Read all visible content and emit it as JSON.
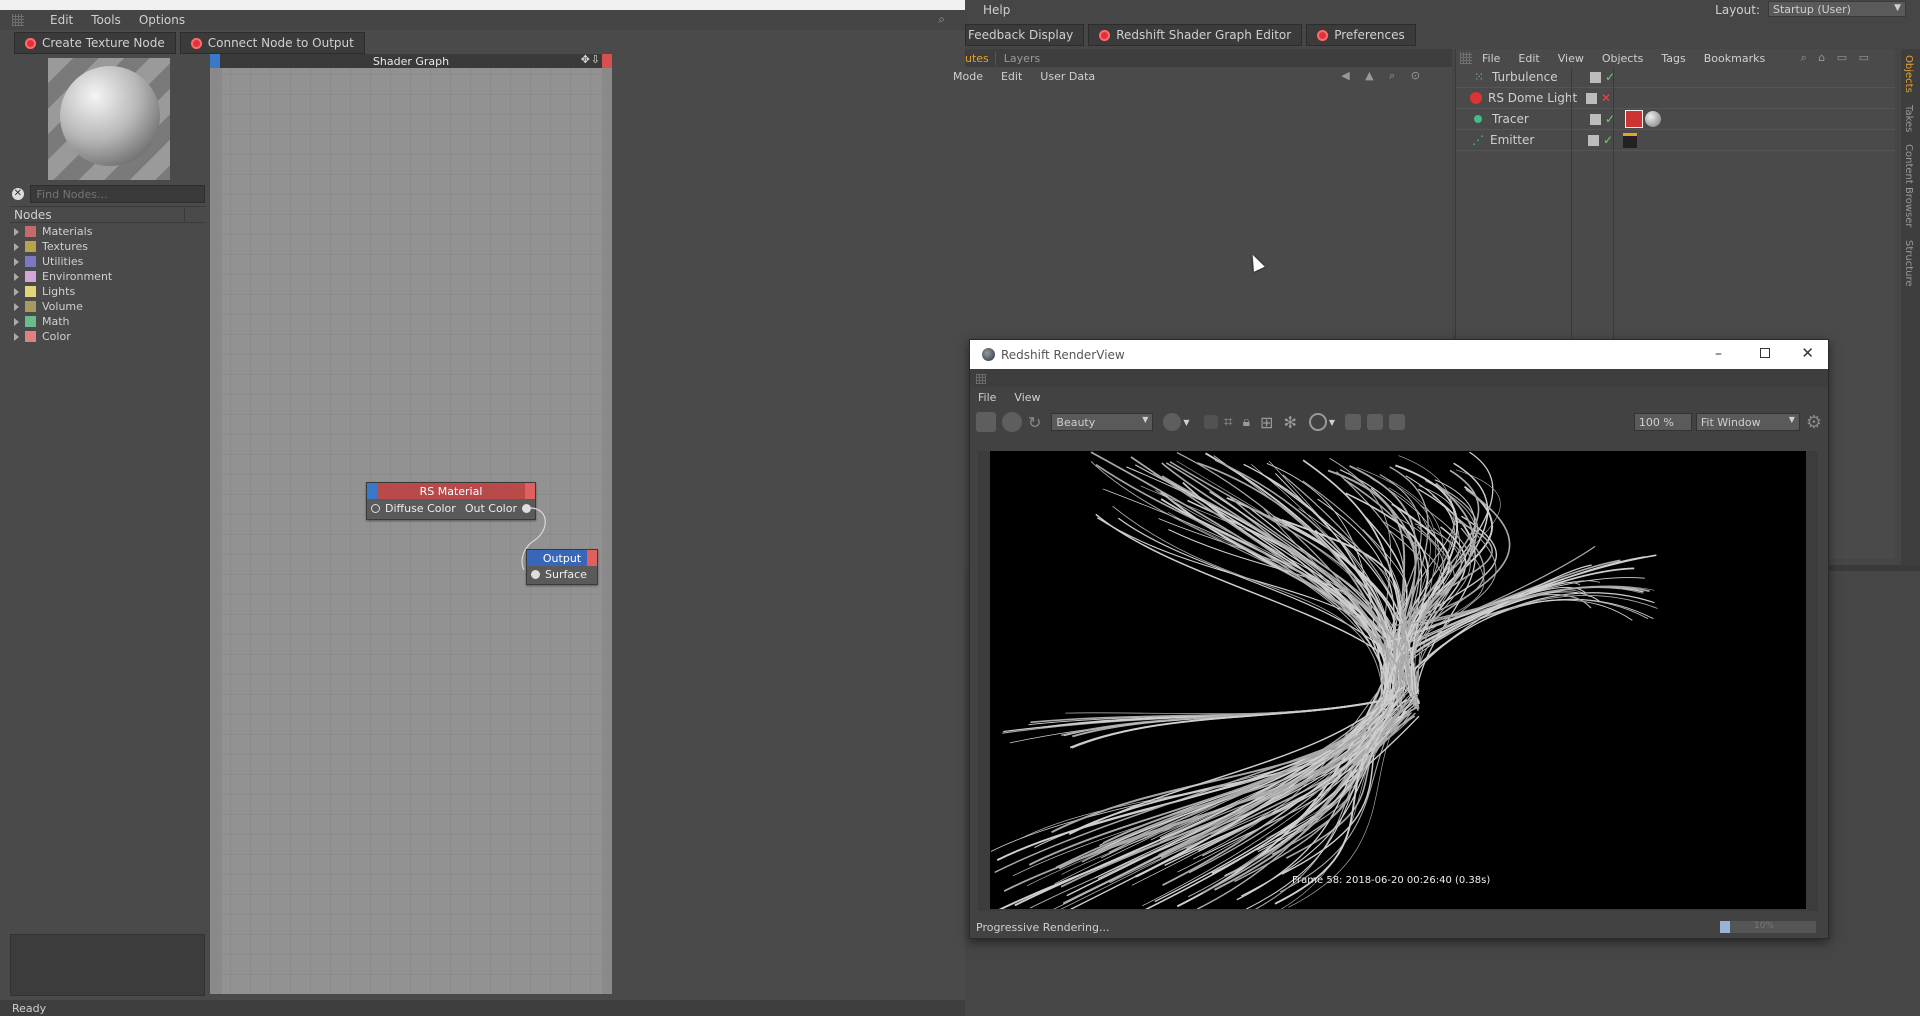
{
  "left_app": {
    "menu": [
      "Edit",
      "Tools",
      "Options"
    ],
    "toolbar": {
      "create_texture": "Create Texture Node",
      "connect_output": "Connect Node to Output"
    },
    "shader_graph_title": "Shader Graph",
    "find_nodes_placeholder": "Find Nodes...",
    "nodes_header": "Nodes",
    "node_categories": [
      {
        "label": "Materials",
        "color": "#c46a6a"
      },
      {
        "label": "Textures",
        "color": "#b8a24e"
      },
      {
        "label": "Utilities",
        "color": "#7d78c4"
      },
      {
        "label": "Environment",
        "color": "#d3a6d6"
      },
      {
        "label": "Lights",
        "color": "#e2d47a"
      },
      {
        "label": "Volume",
        "color": "#a89a5e"
      },
      {
        "label": "Math",
        "color": "#6dbb8c"
      },
      {
        "label": "Color",
        "color": "#e08080"
      }
    ],
    "rs_material": {
      "title": "RS Material",
      "in_port": "Diffuse Color",
      "out_port": "Out Color"
    },
    "output_node": {
      "title": "Output",
      "in_port": "Surface"
    },
    "status": "Ready"
  },
  "c4d": {
    "help_menu": "Help",
    "layout_label": "Layout:",
    "layout_value": "Startup (User)",
    "tabs": [
      {
        "label": "Feedback Display"
      },
      {
        "label": "Redshift Shader Graph Editor"
      },
      {
        "label": "Preferences"
      }
    ],
    "attr_tabs": {
      "attributes": "utes",
      "layers": "Layers"
    },
    "attr_menu": [
      "Mode",
      "Edit",
      "User Data"
    ],
    "obj_menu": [
      "File",
      "Edit",
      "View",
      "Objects",
      "Tags",
      "Bookmarks"
    ],
    "objects": [
      {
        "name": "Turbulence",
        "flag": "✓"
      },
      {
        "name": "RS Dome Light",
        "flag": "✕"
      },
      {
        "name": "Tracer",
        "flag": "✓"
      },
      {
        "name": "Emitter",
        "flag": "✓"
      }
    ],
    "side_tabs": [
      "Objects",
      "Takes",
      "Content Browser",
      "Structure"
    ]
  },
  "renderview": {
    "title": "Redshift RenderView",
    "menu": [
      "File",
      "View"
    ],
    "aov": "Beauty",
    "zoom": "100 %",
    "fit": "Fit Window",
    "frame_info": "Frame 58: 2018-06-20 00:26:40 (0.38s)",
    "status": "Progressive Rendering...",
    "progress_label": "10%",
    "progress": 0.1
  }
}
